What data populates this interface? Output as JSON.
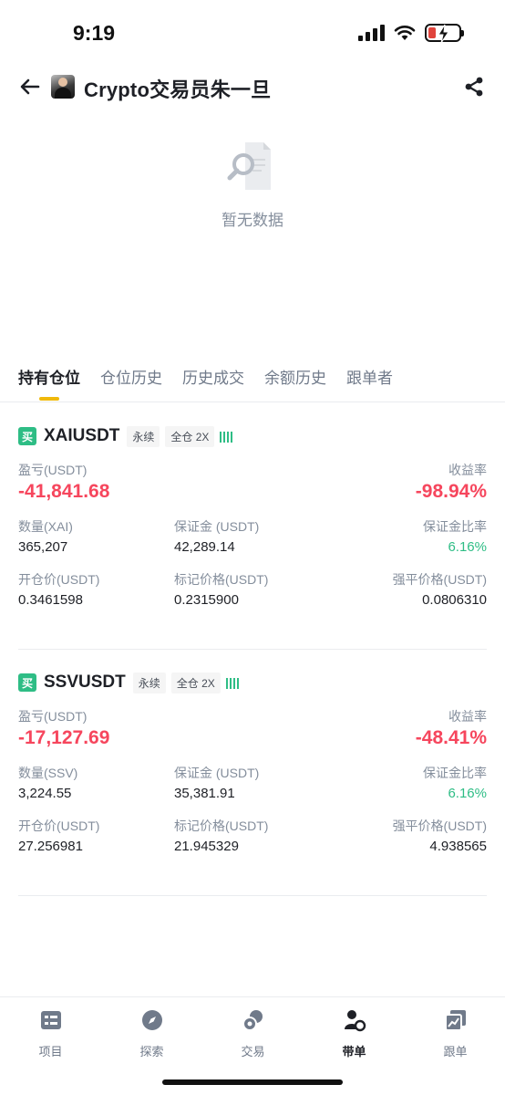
{
  "status_bar": {
    "time": "9:19"
  },
  "header": {
    "title": "Crypto交易员朱一旦"
  },
  "empty_state": {
    "text": "暂无数据"
  },
  "tabs": [
    {
      "label": "持有仓位",
      "active": true
    },
    {
      "label": "仓位历史"
    },
    {
      "label": "历史成交"
    },
    {
      "label": "余额历史"
    },
    {
      "label": "跟单者"
    }
  ],
  "field_labels": {
    "pnl": "盈亏(USDT)",
    "roe": "收益率",
    "margin": "保证金 (USDT)",
    "margin_ratio": "保证金比率",
    "entry_price": "开仓价(USDT)",
    "mark_price": "标记价格(USDT)",
    "liq_price": "强平价格(USDT)"
  },
  "positions": [
    {
      "side": "买",
      "symbol": "XAIUSDT",
      "contract_type": "永续",
      "margin_mode": "全仓 2X",
      "qty_label": "数量(XAI)",
      "pnl": "-41,841.68",
      "roe": "-98.94%",
      "qty": "365,207",
      "margin": "42,289.14",
      "margin_ratio": "6.16%",
      "entry_price": "0.3461598",
      "mark_price": "0.2315900",
      "liq_price": "0.0806310"
    },
    {
      "side": "买",
      "symbol": "SSVUSDT",
      "contract_type": "永续",
      "margin_mode": "全仓 2X",
      "qty_label": "数量(SSV)",
      "pnl": "-17,127.69",
      "roe": "-48.41%",
      "qty": "3,224.55",
      "margin": "35,381.91",
      "margin_ratio": "6.16%",
      "entry_price": "27.256981",
      "mark_price": "21.945329",
      "liq_price": "4.938565"
    }
  ],
  "bottom_nav": [
    {
      "label": "项目",
      "icon": "list-icon"
    },
    {
      "label": "探索",
      "icon": "compass-icon"
    },
    {
      "label": "交易",
      "icon": "trade-icon"
    },
    {
      "label": "带单",
      "icon": "lead-trader-icon",
      "active": true
    },
    {
      "label": "跟单",
      "icon": "copy-chart-icon"
    }
  ],
  "colors": {
    "loss": "#f6465d",
    "profit": "#2ebd85",
    "accent": "#f0b90b"
  }
}
